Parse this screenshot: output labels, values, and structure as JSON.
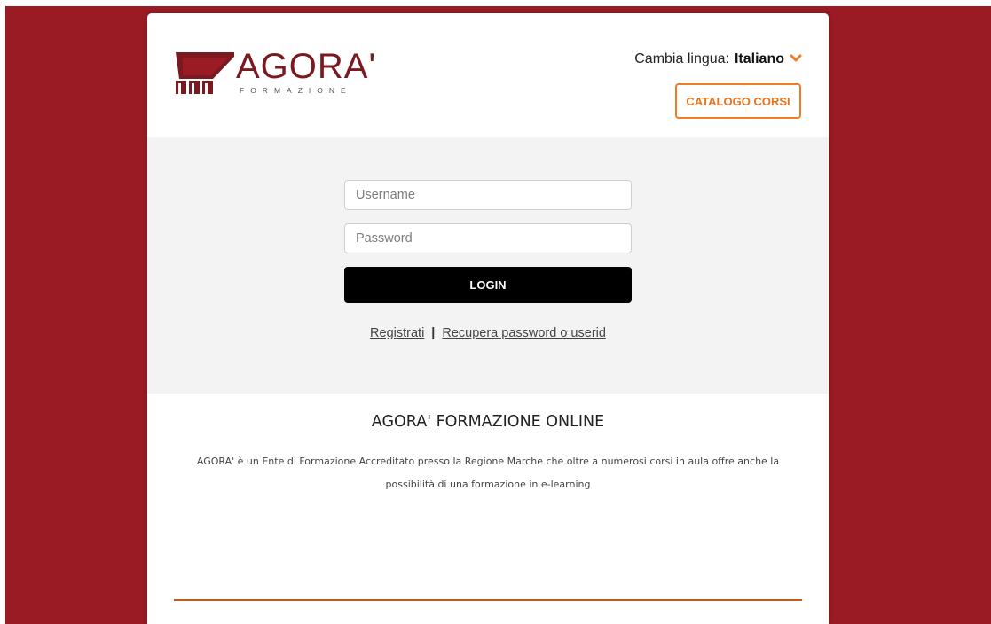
{
  "brand": {
    "name": "AGORA'",
    "subtitle": "FORMAZIONE",
    "color": "#7a1a20"
  },
  "header": {
    "language_label": "Cambia lingua:",
    "language_value": "Italiano",
    "catalog_button": "CATALOGO CORSI"
  },
  "login": {
    "username_placeholder": "Username",
    "password_placeholder": "Password",
    "login_button": "LOGIN",
    "register_link": "Registrati",
    "separator": "|",
    "recover_link": "Recupera password o userid"
  },
  "info": {
    "title": "AGORA' FORMAZIONE ONLINE",
    "text": "AGORA' è un Ente di Formazione Accreditato presso la Regione Marche che oltre a numerosi corsi in aula offre anche la possibilità di una formazione in e-learning"
  },
  "colors": {
    "background": "#9a1b24",
    "accent": "#f07d25",
    "button": "#000000"
  }
}
